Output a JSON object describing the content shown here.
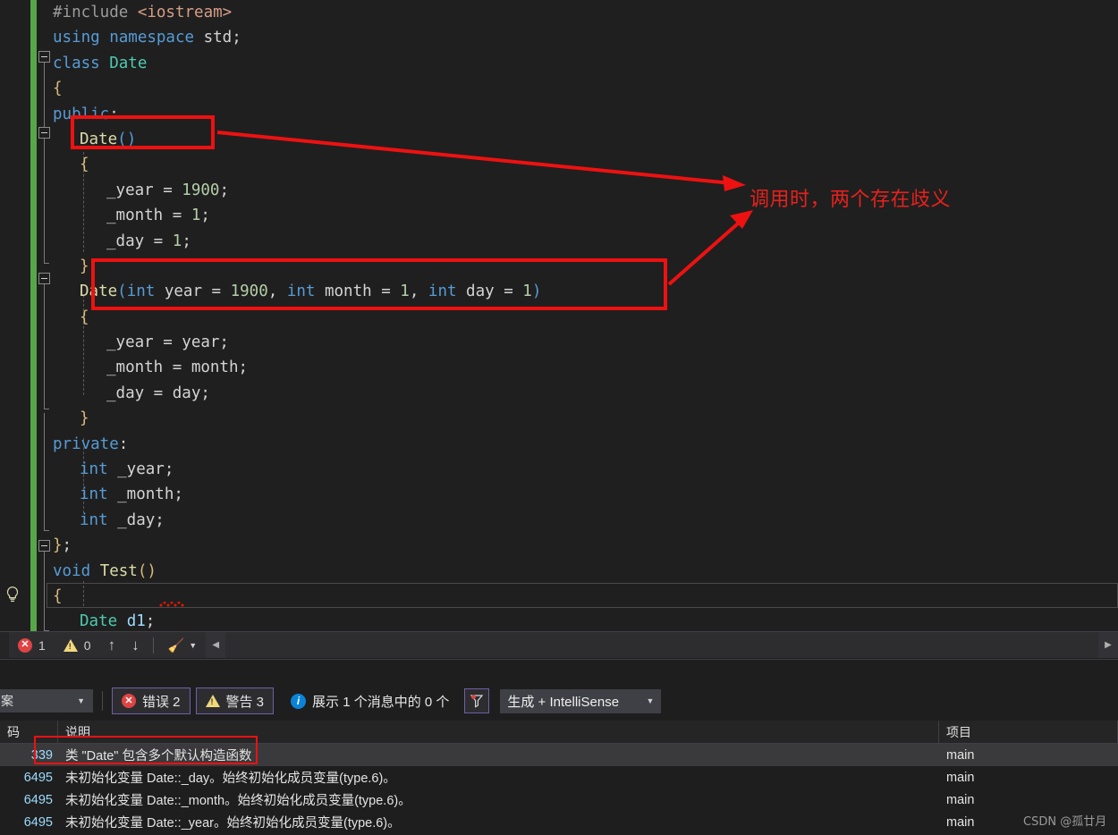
{
  "editor": {
    "lines": [
      {
        "indent": 0,
        "segs": [
          {
            "t": "#include ",
            "c": "pre"
          },
          {
            "t": "<iostream>",
            "c": "str"
          }
        ]
      },
      {
        "indent": 0,
        "segs": [
          {
            "t": "using namespace ",
            "c": "kw"
          },
          {
            "t": "std",
            "c": "pl"
          },
          {
            "t": ";",
            "c": "pl"
          }
        ]
      },
      {
        "indent": 0,
        "segs": [
          {
            "t": "class ",
            "c": "kw"
          },
          {
            "t": "Date",
            "c": "typ"
          }
        ]
      },
      {
        "indent": 0,
        "segs": [
          {
            "t": "{",
            "c": "br"
          }
        ]
      },
      {
        "indent": 0,
        "segs": [
          {
            "t": "public",
            "c": "kw"
          },
          {
            "t": ":",
            "c": "pl"
          }
        ]
      },
      {
        "indent": 1,
        "segs": [
          {
            "t": "Date",
            "c": "fn"
          },
          {
            "t": "()",
            "c": "par"
          }
        ]
      },
      {
        "indent": 1,
        "segs": [
          {
            "t": "{",
            "c": "br"
          }
        ]
      },
      {
        "indent": 2,
        "segs": [
          {
            "t": "_year = ",
            "c": "pl"
          },
          {
            "t": "1900",
            "c": "num"
          },
          {
            "t": ";",
            "c": "pl"
          }
        ]
      },
      {
        "indent": 2,
        "segs": [
          {
            "t": "_month = ",
            "c": "pl"
          },
          {
            "t": "1",
            "c": "num"
          },
          {
            "t": ";",
            "c": "pl"
          }
        ]
      },
      {
        "indent": 2,
        "segs": [
          {
            "t": "_day = ",
            "c": "pl"
          },
          {
            "t": "1",
            "c": "num"
          },
          {
            "t": ";",
            "c": "pl"
          }
        ]
      },
      {
        "indent": 1,
        "segs": [
          {
            "t": "}",
            "c": "br"
          }
        ]
      },
      {
        "indent": 1,
        "segs": [
          {
            "t": "Date",
            "c": "fn"
          },
          {
            "t": "(",
            "c": "par"
          },
          {
            "t": "int",
            "c": "kw"
          },
          {
            "t": " year = ",
            "c": "pl"
          },
          {
            "t": "1900",
            "c": "num"
          },
          {
            "t": ", ",
            "c": "pl"
          },
          {
            "t": "int",
            "c": "kw"
          },
          {
            "t": " month = ",
            "c": "pl"
          },
          {
            "t": "1",
            "c": "num"
          },
          {
            "t": ", ",
            "c": "pl"
          },
          {
            "t": "int",
            "c": "kw"
          },
          {
            "t": " day = ",
            "c": "pl"
          },
          {
            "t": "1",
            "c": "num"
          },
          {
            "t": ")",
            "c": "par"
          }
        ]
      },
      {
        "indent": 1,
        "segs": [
          {
            "t": "{",
            "c": "br"
          }
        ]
      },
      {
        "indent": 2,
        "segs": [
          {
            "t": "_year = year;",
            "c": "pl"
          }
        ]
      },
      {
        "indent": 2,
        "segs": [
          {
            "t": "_month = month;",
            "c": "pl"
          }
        ]
      },
      {
        "indent": 2,
        "segs": [
          {
            "t": "_day = day;",
            "c": "pl"
          }
        ]
      },
      {
        "indent": 1,
        "segs": [
          {
            "t": "}",
            "c": "br"
          }
        ]
      },
      {
        "indent": 0,
        "segs": [
          {
            "t": "private",
            "c": "kw"
          },
          {
            "t": ":",
            "c": "pl"
          }
        ]
      },
      {
        "indent": 1,
        "segs": [
          {
            "t": "int",
            "c": "kw"
          },
          {
            "t": " _year;",
            "c": "pl"
          }
        ]
      },
      {
        "indent": 1,
        "segs": [
          {
            "t": "int",
            "c": "kw"
          },
          {
            "t": " _month;",
            "c": "pl"
          }
        ]
      },
      {
        "indent": 1,
        "segs": [
          {
            "t": "int",
            "c": "kw"
          },
          {
            "t": " _day;",
            "c": "pl"
          }
        ]
      },
      {
        "indent": 0,
        "segs": [
          {
            "t": "}",
            "c": "br"
          },
          {
            "t": ";",
            "c": "pl"
          }
        ]
      },
      {
        "indent": 0,
        "segs": [
          {
            "t": "void ",
            "c": "kw"
          },
          {
            "t": "Test",
            "c": "fn"
          },
          {
            "t": "()",
            "c": "par2"
          }
        ]
      },
      {
        "indent": 0,
        "segs": [
          {
            "t": "{",
            "c": "br"
          }
        ]
      },
      {
        "indent": 1,
        "segs": [
          {
            "t": "Date",
            "c": "typ"
          },
          {
            "t": " ",
            "c": "pl"
          },
          {
            "t": "d1",
            "c": "id"
          },
          {
            "t": ";",
            "c": "pl"
          }
        ]
      },
      {
        "indent": 0,
        "segs": [
          {
            "t": "}",
            "c": "br"
          }
        ]
      }
    ],
    "annotation": "调用时，两个存在歧义",
    "annotation_color": "#e8211c",
    "highlight_boxes": [
      "Date()",
      "Date(int year = 1900, int month = 1, int day = 1)"
    ],
    "current_line_text": "Date d1;",
    "lightbulb_icon": "lightbulb-icon",
    "change_bar_color": "#57a64a"
  },
  "statusbar": {
    "error_icon": "error-circle-icon",
    "error_count": "1",
    "warning_icon": "warning-triangle-icon",
    "warning_count": "0",
    "prev_icon": "arrow-up-icon",
    "next_icon": "arrow-down-icon",
    "broom_icon": "broom-icon",
    "dropdown_icon": "chevron-down-icon",
    "scroll_left_icon": "scroll-left-icon",
    "scroll_right_icon": "scroll-right-icon"
  },
  "errorlist": {
    "scope_combo_value": "案",
    "errors_label": "错误 2",
    "warnings_label": "警告 3",
    "messages_label": "展示 1 个消息中的 0 个",
    "filter_icon": "filter-funnel-icon",
    "build_combo_value": "生成 + IntelliSense",
    "columns": [
      "码",
      "说明",
      "项目"
    ],
    "rows": [
      {
        "code": "339",
        "desc": "类 \"Date\" 包含多个默认构造函数",
        "project": "main",
        "selected": true
      },
      {
        "code": "6495",
        "desc": "未初始化变量 Date::_day。始终初始化成员变量(type.6)。",
        "project": "main",
        "selected": false
      },
      {
        "code": "6495",
        "desc": "未初始化变量 Date::_month。始终初始化成员变量(type.6)。",
        "project": "main",
        "selected": false
      },
      {
        "code": "6495",
        "desc": "未初始化变量 Date::_year。始终初始化成员变量(type.6)。",
        "project": "main",
        "selected": false
      }
    ]
  },
  "watermark": "CSDN @孤廿月"
}
